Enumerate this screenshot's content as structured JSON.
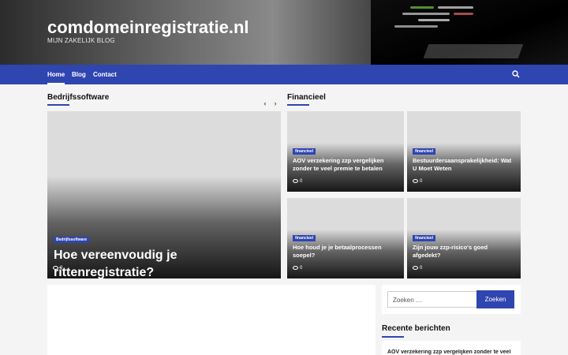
{
  "site": {
    "title": "comdomeinregistratie.nl",
    "tagline": "MIJN ZAKELIJK BLOG"
  },
  "nav": {
    "items": [
      "Home",
      "Blog",
      "Contact"
    ]
  },
  "sections": {
    "left": "Bedrijfssoftware",
    "right": "Financieel"
  },
  "slider": {
    "prev": "‹",
    "next": "›"
  },
  "featured": {
    "category": "Bedrijfssoftware",
    "title": "Hoe vereenvoudig je rittenregistratie?",
    "comments": "0"
  },
  "grid": [
    {
      "category": "financieel",
      "title": "AOV verzekering zzp vergelijken zonder te veel premie te betalen",
      "comments": "0"
    },
    {
      "category": "financieel",
      "title": "Bestuurdersaansprakelijkheid: Wat U Moet Weten",
      "comments": "0"
    },
    {
      "category": "financieel",
      "title": "Hoe houd je je betaalprocessen soepel?",
      "comments": "0"
    },
    {
      "category": "financieel",
      "title": "Zijn jouw zzp-risico's goed afgedekt?",
      "comments": "0"
    }
  ],
  "search": {
    "placeholder": "Zoeken …",
    "button": "Zoeken"
  },
  "recent": {
    "title": "Recente berichten",
    "items": [
      "AOV verzekering zzp vergelijken zonder te veel"
    ]
  },
  "colors": {
    "accent": "#2f45b0"
  }
}
